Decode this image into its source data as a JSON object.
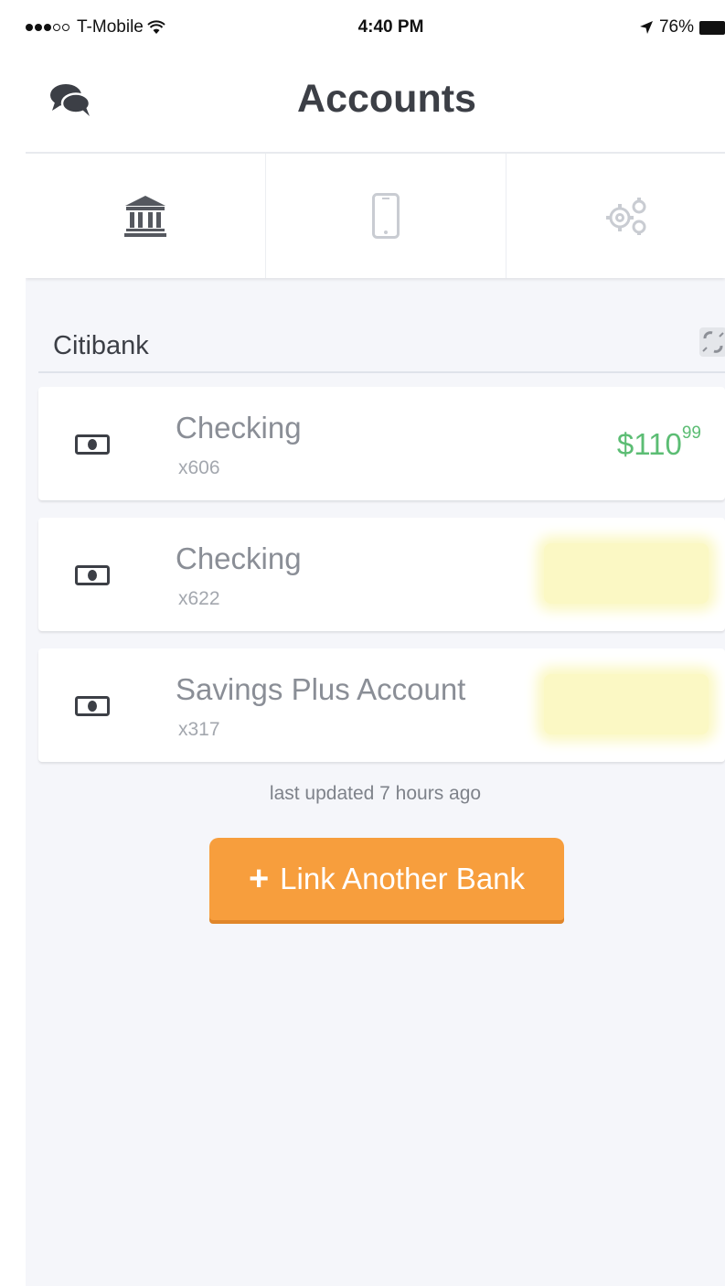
{
  "status_bar": {
    "carrier": "T-Mobile",
    "time": "4:40 PM",
    "battery": "76%"
  },
  "header": {
    "title": "Accounts"
  },
  "tabs": [
    {
      "icon": "bank-icon",
      "active": true
    },
    {
      "icon": "phone-icon",
      "active": false
    },
    {
      "icon": "gears-icon",
      "active": false
    }
  ],
  "bank": {
    "name": "Citibank",
    "accounts": [
      {
        "name": "Checking",
        "number": "x606",
        "balance_dollars": "$110",
        "balance_cents": "99",
        "balance_visible": true
      },
      {
        "name": "Checking",
        "number": "x622",
        "balance_visible": false
      },
      {
        "name": "Savings Plus Account",
        "number": "x317",
        "balance_visible": false
      }
    ],
    "last_updated": "last updated 7 hours ago"
  },
  "actions": {
    "link_bank_label": "Link Another Bank"
  },
  "colors": {
    "accent_orange": "#f79e3d",
    "balance_green": "#5cbd74",
    "background": "#f5f6fa"
  }
}
